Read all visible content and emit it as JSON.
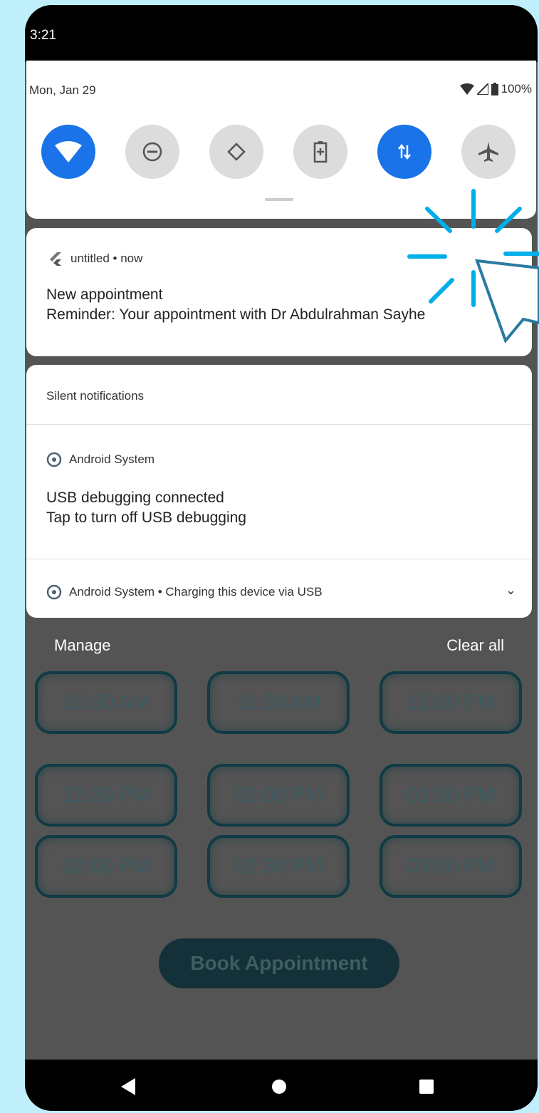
{
  "status_bar": {
    "time": "3:21"
  },
  "quick_settings": {
    "date": "Mon, Jan 29",
    "battery": "100%",
    "tiles": [
      {
        "name": "wifi",
        "on": true
      },
      {
        "name": "do-not-disturb",
        "on": false
      },
      {
        "name": "auto-rotate",
        "on": false
      },
      {
        "name": "battery-saver",
        "on": false
      },
      {
        "name": "mobile-data",
        "on": true
      },
      {
        "name": "airplane-mode",
        "on": false
      }
    ]
  },
  "notification": {
    "app": "untitled • now",
    "title": "New appointment",
    "body": "Reminder: Your appointment with Dr Abdulrahman Sayhe"
  },
  "silent": {
    "header": "Silent notifications",
    "usb_app": "Android System",
    "usb_title": "USB debugging connected",
    "usb_body": "Tap to turn off USB debugging",
    "charging": "Android System • Charging this device via USB"
  },
  "footer": {
    "manage": "Manage",
    "clear_all": "Clear all"
  },
  "time_slots": [
    "10:30 AM",
    "11:30 AM",
    "12:00 PM",
    "12:30 PM",
    "01:00 PM",
    "01:30 PM",
    "02:00 PM",
    "02:30 PM",
    "03:00 PM"
  ],
  "book_button": "Book Appointment",
  "colors": {
    "accent": "#1a73e8",
    "cursor": "#00aee8",
    "background": "#bfeffa"
  }
}
